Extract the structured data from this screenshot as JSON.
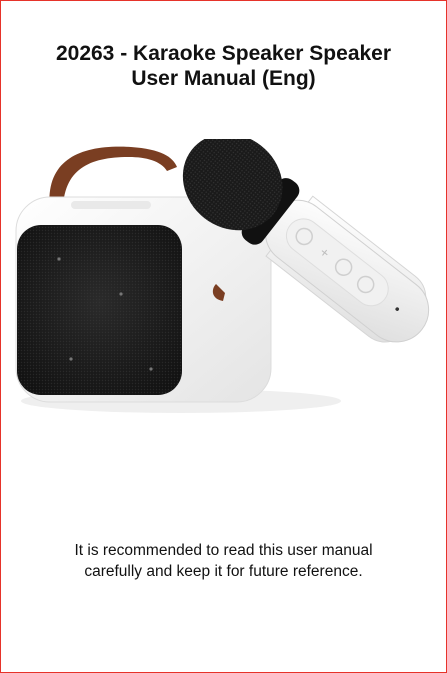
{
  "document": {
    "title_line1": "20263 - Karaoke Speaker Speaker",
    "title_line2": "User Manual (Eng)",
    "note_line1": "It is recommended to read this user manual",
    "note_line2": "carefully and keep it for future reference."
  },
  "colors": {
    "border": "#e6332a",
    "text": "#111111",
    "strap": "#7a3e22",
    "grille": "#1b1b1b",
    "body": "#f4f4f4"
  },
  "icons": [
    "speaker-image",
    "microphone-image"
  ]
}
